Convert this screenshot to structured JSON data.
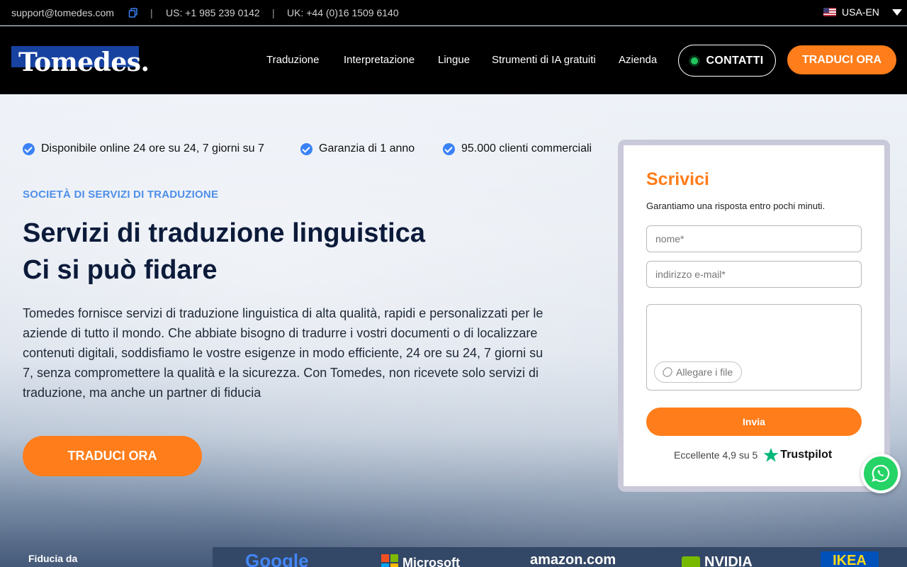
{
  "topbar": {
    "email": "support@tomedes.com",
    "separator": "|",
    "us_phone": "US: +1 985 239 0142",
    "uk_phone": "UK: +44 (0)16 1509 6140",
    "locale": "USA-EN"
  },
  "nav": {
    "logo": "Tomedes.",
    "items": [
      "Traduzione",
      "Interpretazione",
      "Lingue",
      "Strumenti di IA gratuiti",
      "Azienda"
    ],
    "contact_label": "CONTATTI",
    "cta_label": "TRADUCI ORA"
  },
  "hero": {
    "features": [
      "Disponibile online 24 ore su 24, 7 giorni su 7",
      "Garanzia di 1 anno",
      "95.000 clienti commerciali"
    ],
    "eyebrow": "SOCIETÀ DI SERVIZI DI TRADUZIONE",
    "headline_line1": "Servizi di traduzione linguistica",
    "headline_line2": "Ci si può fidare",
    "description": "Tomedes fornisce servizi di traduzione linguistica di alta qualità, rapidi e personalizzati per le aziende di tutto il mondo. Che abbiate bisogno di tradurre i vostri documenti o di localizzare contenuti digitali, soddisfiamo le vostre esigenze in modo efficiente, 24 ore su 24, 7 giorni su 7, senza compromettere la qualità e la sicurezza. Con Tomedes, non ricevete solo servizi di traduzione, ma anche un partner di fiducia",
    "cta_label": "TRADUCI ORA"
  },
  "form": {
    "title": "Scrivici",
    "subtitle": "Garantiamo una risposta entro pochi minuti.",
    "name_placeholder": "nome*",
    "email_placeholder": "indirizzo e-mail*",
    "attach_label": "Allegare i file",
    "submit_label": "Invia",
    "rating_text": "Eccellente 4,9 su 5",
    "rating_brand": "Trustpilot"
  },
  "trust": {
    "label": "Fiducia da",
    "brands": [
      "Google",
      "Microsoft",
      "amazon.com",
      "NVIDIA",
      "IKEA"
    ]
  },
  "colors": {
    "accent": "#ff7d1a",
    "link_blue": "#4f8fe8",
    "headline": "#0c1b3a",
    "check_blue": "#3b82f6",
    "whatsapp": "#25d366",
    "trustpilot": "#00b67a"
  },
  "icons": [
    "copy-icon",
    "us-flag-icon",
    "chevron-down-icon",
    "check-circle-icon",
    "paperclip-icon",
    "trustpilot-star-icon",
    "whatsapp-icon"
  ]
}
